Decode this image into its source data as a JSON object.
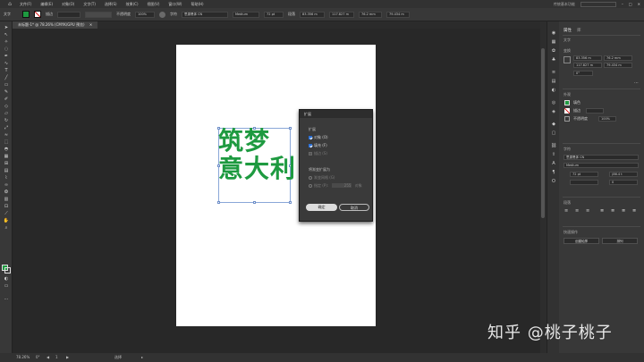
{
  "menubar": {
    "items": [
      "文件(F)",
      "编辑(E)",
      "对象(O)",
      "文字(T)",
      "选择(S)",
      "效果(C)",
      "视图(V)",
      "窗口(W)",
      "帮助(H)"
    ],
    "workspace": "传统基本功能"
  },
  "controlbar": {
    "selection_label": "文字",
    "fill_color": "#1e9a40",
    "stroke_label": "描边",
    "opacity_label": "不透明度",
    "opacity_value": "100%",
    "char_label": "字符",
    "font_family": "思源黑体 CN",
    "font_style": "Medium",
    "font_size": "72 pt",
    "paragraph_label": "段落",
    "x_value": "83.356 m",
    "y_value": "117.827 m",
    "w_value": "76.2 mm",
    "h_value": "79.434 m"
  },
  "document_tab": {
    "title": "未标题-1* @ 78.26% (CMYK/GPU 预览)"
  },
  "artwork": {
    "line1": "筑梦",
    "line2": "意大利",
    "text_color": "#1e9a40"
  },
  "dialog": {
    "title": "扩展",
    "section_expand": "扩展",
    "object_label": "对象 (O)",
    "object_checked": true,
    "fill_label": "填充 (F)",
    "fill_checked": true,
    "stroke_label": "描边 (S)",
    "stroke_checked": false,
    "gradient_section": "将渐变扩展为",
    "gradient_mesh_label": "渐变网格 (G)",
    "specify_label": "指定 (P):",
    "specify_value": "255",
    "specify_unit": "对象",
    "ok_label": "确定",
    "cancel_label": "取消"
  },
  "panel": {
    "tabs": [
      "属性",
      "库"
    ],
    "section_text": "文字",
    "section_transform": "变换",
    "x_value": "83.356 m",
    "y_value": "117.827 m",
    "w_value": "76.2 mm",
    "h_value": "79.434 m",
    "angle_value": "0°",
    "section_appearance": "外观",
    "fill_label": "填色",
    "stroke_label": "描边",
    "opacity_label": "不透明度",
    "opacity_value": "100%",
    "section_character": "字符",
    "font_family": "思源黑体 CN",
    "font_style": "Medium",
    "font_size": "72 pt",
    "leading_value": "(86.4 t",
    "tracking_value": "0",
    "section_paragraph": "段落",
    "section_quick": "快速操作",
    "create_outlines": "创建轮廓",
    "arrange": "排列"
  },
  "statusbar": {
    "zoom": "78.26%",
    "page": "1",
    "angle": "0°",
    "tool": "选择"
  },
  "watermark": {
    "text": "知乎 @桃子桃子"
  }
}
